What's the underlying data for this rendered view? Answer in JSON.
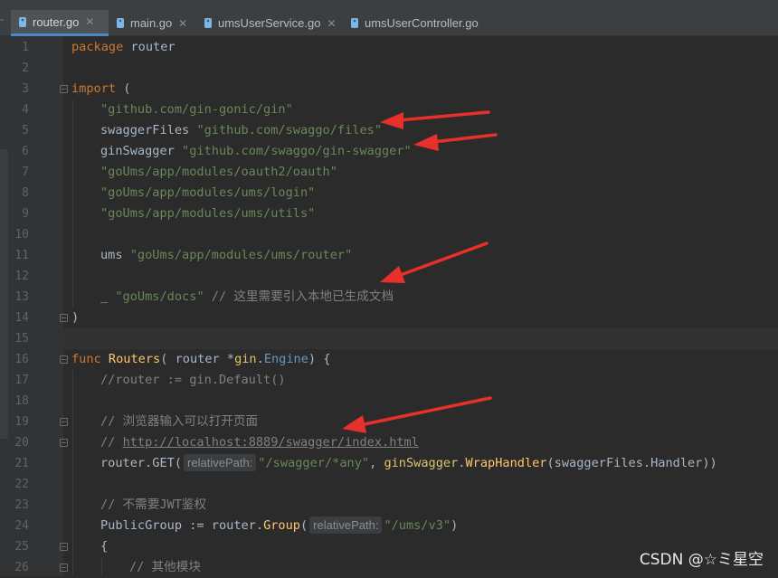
{
  "tabs": [
    {
      "label": "router.go",
      "active": true
    },
    {
      "label": "main.go",
      "active": false
    },
    {
      "label": "umsUserService.go",
      "active": false
    },
    {
      "label": "umsUserController.go",
      "active": false
    }
  ],
  "line_numbers": [
    "1",
    "2",
    "3",
    "4",
    "5",
    "6",
    "7",
    "8",
    "9",
    "10",
    "11",
    "12",
    "13",
    "14",
    "15",
    "16",
    "17",
    "18",
    "19",
    "20",
    "21",
    "22",
    "23",
    "24",
    "25",
    "26"
  ],
  "code": {
    "l1_kw": "package",
    "l1_name": " router",
    "l3_kw": "import",
    "l3_paren": " (",
    "l4_str": "\"github.com/gin-gonic/gin\"",
    "l5_alias": "swaggerFiles ",
    "l5_str": "\"github.com/swaggo/files\"",
    "l6_alias": "ginSwagger ",
    "l6_str": "\"github.com/swaggo/gin-swagger\"",
    "l7_str": "\"goUms/app/modules/oauth2/oauth\"",
    "l8_str": "\"goUms/app/modules/ums/login\"",
    "l9_str": "\"goUms/app/modules/ums/utils\"",
    "l11_alias": "ums ",
    "l11_str": "\"goUms/app/modules/ums/router\"",
    "l13_blank": "_ ",
    "l13_str": "\"goUms/docs\"",
    "l13_cmt": " // 这里需要引入本地已生成文档",
    "l14": ")",
    "l16_kw": "func ",
    "l16_fn": "Routers",
    "l16_a": "( router *",
    "l16_pkg": "gin",
    "l16_b": ".",
    "l16_type": "Engine",
    "l16_c": ") {",
    "l17_cmt": "//router := gin.Default()",
    "l19_cmt": "// 浏览器输入可以打开页面",
    "l20_cmt": "// ",
    "l20_link": "http://localhost:8889/swagger/index.html",
    "l21_a": "router.GET(",
    "l21_hint": "relativePath:",
    "l21_str": "\"/swagger/*any\"",
    "l21_b": ", ",
    "l21_pkg": "ginSwagger",
    "l21_c": ".",
    "l21_fn": "WrapHandler",
    "l21_d": "(swaggerFiles.Handler))",
    "l23_cmt": "// 不需要JWT鉴权",
    "l24_a": "PublicGroup := router.",
    "l24_fn": "Group",
    "l24_b": "(",
    "l24_hint": "relativePath:",
    "l24_str": "\"/ums/v3\"",
    "l24_c": ")",
    "l25": "{",
    "l26_cmt": "// 其他模块"
  },
  "watermark": "CSDN @☆ミ星空",
  "colors": {
    "background": "#2b2b2b",
    "keyword": "#cc7832",
    "string": "#6a8759",
    "comment": "#808080",
    "function": "#ffc66d",
    "arrow": "#e8302a"
  }
}
